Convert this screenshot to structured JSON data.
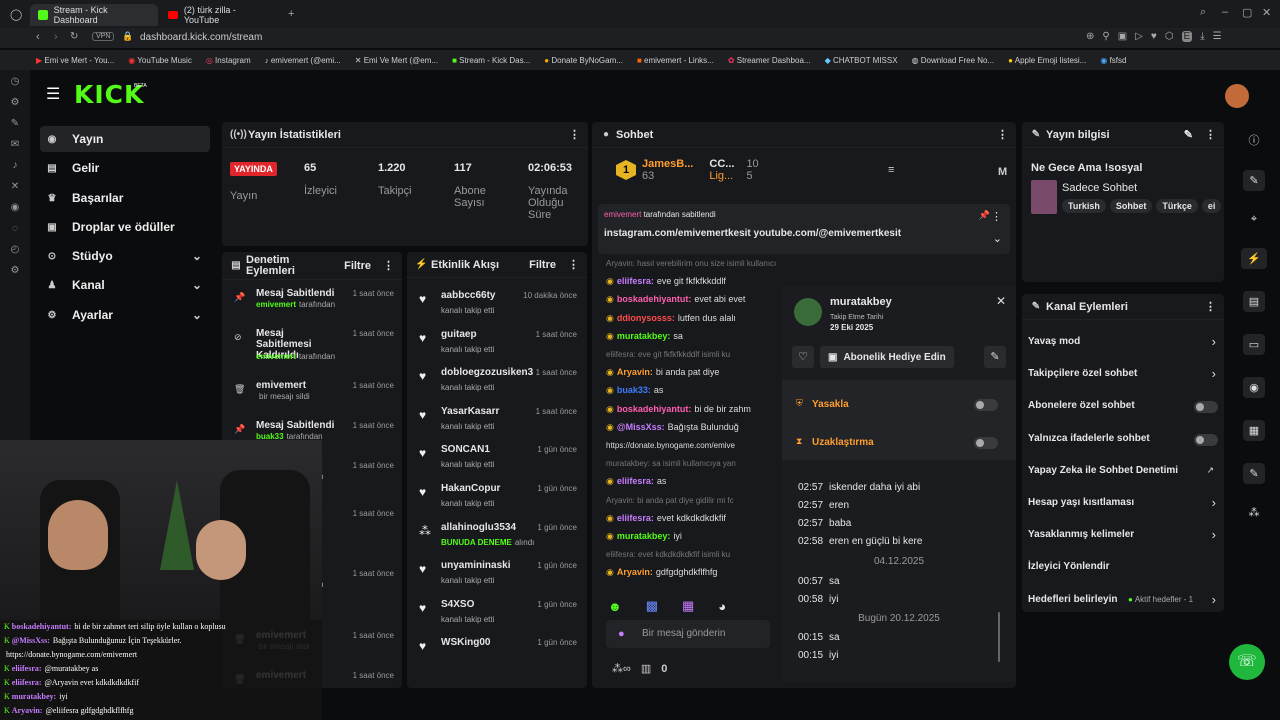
{
  "browser": {
    "tabs": [
      {
        "label": "Stream - Kick Dashboard"
      },
      {
        "label": "(2) türk zilla - YouTube"
      }
    ],
    "vpn": "VPN",
    "url": "dashboard.kick.com/stream",
    "bookmarks": [
      "Emi ve Mert - You...",
      "YouTube Music",
      "Instagram",
      "emivemert (@emi...",
      "Emi Ve Mert (@em...",
      "Stream - Kick Das...",
      "Donate ByNoGam...",
      "emivemert - Links...",
      "Streamer Dashboa...",
      "CHATBOT MISSX",
      "Download Free No...",
      "Apple Emoji listesi...",
      "fsfsd"
    ]
  },
  "kick": {
    "logo": "KICK",
    "beta": "BETA"
  },
  "nav": [
    {
      "label": "Yayın",
      "icon": "broadcast-icon"
    },
    {
      "label": "Gelir",
      "icon": "revenue-icon"
    },
    {
      "label": "Başarılar",
      "icon": "trophy-icon"
    },
    {
      "label": "Droplar ve ödüller",
      "icon": "gift-icon"
    },
    {
      "label": "Stüdyo",
      "icon": "studio-icon"
    },
    {
      "label": "Kanal",
      "icon": "channel-icon"
    },
    {
      "label": "Ayarlar",
      "icon": "gear-icon"
    }
  ],
  "stats": {
    "title": "Yayın İstatistikleri",
    "live_badge": "YAYINDA",
    "live_label": "Yayın",
    "viewers": "65",
    "viewers_label": "İzleyici",
    "followers": "1.220",
    "followers_label": "Takipçi",
    "subs": "117",
    "subs_label": "Abone Sayısı",
    "duration": "02:06:53",
    "duration_label": "Yayında Olduğu Süre"
  },
  "mod": {
    "title": "Denetim Eylemleri",
    "filter": "Filtre",
    "items": [
      {
        "title": "Mesaj Sabitlendi",
        "time": "1 saat önce",
        "sub_user": "emivemert",
        "sub": "tarafından"
      },
      {
        "title": "Mesaj Sabitlemesi Kaldırıldı",
        "time": "1 saat önce",
        "sub_user": "emivemert",
        "sub": "tarafından"
      },
      {
        "title": "emivemert",
        "time": "1 saat önce",
        "sub_user": "",
        "sub": "bir mesajı sildi"
      },
      {
        "title": "Mesaj Sabitlendi",
        "time": "1 saat önce",
        "sub_user": "buak33",
        "sub": "tarafından"
      },
      {
        "title": "",
        "time": "1 saat önce",
        "sub_user": "",
        "sub": "ndan 1 hafta etten"
      },
      {
        "title": "",
        "time": "1 saat önce",
        "sub_user": "",
        "sub": "n yasağı"
      },
      {
        "title": "",
        "time": "1 saat önce",
        "sub_user": "",
        "sub": "ndan 1 hafta etten"
      },
      {
        "title": "emivemert",
        "time": "1 saat önce",
        "sub_user": "",
        "sub": "bir mesajı sildi"
      },
      {
        "title": "emivemert",
        "time": "1 saat önce",
        "sub_user": "",
        "sub": ""
      }
    ]
  },
  "activity": {
    "title": "Etkinlik Akışı",
    "filter": "Filtre",
    "items": [
      {
        "name": "aabbcc66ty",
        "time": "10 dakika önce",
        "sub": "kanalı takip etti"
      },
      {
        "name": "guitaep",
        "time": "1 saat önce",
        "sub": "kanalı takip etti"
      },
      {
        "name": "dobloegzozusiken3153",
        "time": "1 saat önce",
        "sub": "kanalı takip etti"
      },
      {
        "name": "YasarKasarr",
        "time": "1 saat önce",
        "sub": "kanalı takip etti"
      },
      {
        "name": "SONCAN1",
        "time": "1 gün önce",
        "sub": "kanalı takip etti"
      },
      {
        "name": "HakanCopur",
        "time": "1 gün önce",
        "sub": "kanalı takip etti"
      },
      {
        "name": "allahinoglu3534",
        "time": "1 gün önce",
        "sub_hl": "BUNUDA DENEME",
        "sub": "alındı"
      },
      {
        "name": "unyamininaski",
        "time": "1 gün önce",
        "sub": "kanalı takip etti"
      },
      {
        "name": "S4XSO",
        "time": "1 gün önce",
        "sub": "kanalı takip etti"
      },
      {
        "name": "WSKing00",
        "time": "1 gün önce",
        "sub": ""
      }
    ]
  },
  "chat": {
    "title": "Sohbet",
    "leader1": {
      "name": "JamesB...",
      "count": "63"
    },
    "leader2": {
      "name": "CC...",
      "count": "10"
    },
    "leader3": {
      "name": "Lig...",
      "count": "5"
    },
    "pinned_user": "emivemert",
    "pinned_by": "tarafından sabitlendi",
    "pinned_text": "instagram.com/emivemertkesit youtube.com/@emivemertkesit",
    "lines": [
      {
        "user": "",
        "text": "Aryavin: hasıl verebilirim onu size isimli kullanıcıya yanıt veriyor",
        "color": "#777"
      },
      {
        "user": "eliifesra:",
        "text": "eve git fkfkfkkddlf",
        "color": "#c77dff"
      },
      {
        "user": "boskadehiyantut:",
        "text": "evet abi evet",
        "color": "#ff5fb0"
      },
      {
        "user": "ddionysosss:",
        "text": "lutfen dus alalı",
        "color": "#ff4d4d"
      },
      {
        "user": "muratakbey:",
        "text": "sa",
        "color": "#53fc18"
      },
      {
        "user": "",
        "text": "eliifesra: eve git fkfkfkkddlf isimli ku",
        "color": "#777"
      },
      {
        "user": "Aryavin:",
        "text": "bi anda pat diye",
        "color": "#ff9d2e"
      },
      {
        "user": "buak33:",
        "text": "as",
        "color": "#3d7bff"
      },
      {
        "user": "boskadehiyantut:",
        "text": "bi de bir zahm",
        "color": "#ff5fb0"
      },
      {
        "user": "@MissXss:",
        "text": "Bağışta Bulunduğ",
        "color": "#c77dff"
      },
      {
        "user": "",
        "text": "https://donate.bynogame.com/emive",
        "color": "#ddd"
      },
      {
        "user": "",
        "text": "muratakbey: sa isimli kullanıcıya yan",
        "color": "#777"
      },
      {
        "user": "eliifesra:",
        "text": "as",
        "color": "#c77dff"
      },
      {
        "user": "",
        "text": "Aryavin: bi anda pat diye gidilir mi fc",
        "color": "#777"
      },
      {
        "user": "eliifesra:",
        "text": "evet kdkdkdkdkfif",
        "color": "#c77dff"
      },
      {
        "user": "muratakbey:",
        "text": "iyi",
        "color": "#53fc18"
      },
      {
        "user": "",
        "text": "eliifesra: evet kdkdkdkdkfif isimli ku",
        "color": "#777"
      },
      {
        "user": "Aryavin:",
        "text": "gdfgdghdkflfhfg",
        "color": "#ff9d2e"
      }
    ],
    "input_placeholder": "Bir mesaj gönderin",
    "points": "0"
  },
  "usercard": {
    "name": "muratakbey",
    "follow_label": "Takip Etme Tarihi",
    "follow_date": "29 Eki 2025",
    "gift_sub": "Abonelik Hediye Edin",
    "ban": "Yasakla",
    "timeout": "Uzaklaştırma",
    "messages": [
      {
        "time": "02:57",
        "text": "iskender daha iyi abi"
      },
      {
        "time": "02:57",
        "text": "eren"
      },
      {
        "time": "02:57",
        "text": "baba"
      },
      {
        "time": "02:58",
        "text": "eren en güçlü bi kere"
      }
    ],
    "date1": "04.12.2025",
    "messages2": [
      {
        "time": "00:57",
        "text": "sa"
      },
      {
        "time": "00:58",
        "text": "iyi"
      }
    ],
    "date2": "Bugün 20.12.2025",
    "messages3": [
      {
        "time": "00:15",
        "text": "sa"
      },
      {
        "time": "00:15",
        "text": "iyi"
      }
    ]
  },
  "streaminfo": {
    "title": "Yayın bilgisi",
    "stream_title": "Ne Gece Ama !sosyal",
    "category": "Sadece Sohbet",
    "tags": [
      "Turkish",
      "Sohbet",
      "Türkçe",
      "ei"
    ]
  },
  "channel_actions": {
    "title": "Kanal Eylemleri",
    "items": [
      "Yavaş mod",
      "Takipçilere özel sohbet",
      "Abonelere özel sohbet",
      "Yalnızca ifadelerle sohbet",
      "Yapay Zeka ile Sohbet Denetimi",
      "Hesap yaşı kısıtlaması",
      "Yasaklanmış kelimeler",
      "İzleyici Yönlendir",
      "Hedefleri belirleyin"
    ],
    "goal_status": "Aktif hedefler - 1"
  },
  "overlay_chat": [
    {
      "user": "boskadehiyantut:",
      "text": "bi de bir zahmet teri silip öyle kullan o koplusu"
    },
    {
      "user": "@MissXss:",
      "text": "Bağışta Bulunduğunuz İçin Teşekkürler."
    },
    {
      "user": "",
      "text": "https://donate.bynogame.com/emivemert"
    },
    {
      "user": "eliifesra:",
      "text": "@muratakbey as"
    },
    {
      "user": "eliifesra:",
      "text": "@Aryavin evet kdkdkdkdkfif"
    },
    {
      "user": "muratakbey:",
      "text": "iyi"
    },
    {
      "user": "Aryavin:",
      "text": "@eliifesra gdfgdghdkflfhfg"
    }
  ],
  "colors": {
    "kick_green": "#53fc18",
    "live_red": "#e0262b",
    "panel": "#18191c",
    "bg": "#0b0c0e"
  }
}
